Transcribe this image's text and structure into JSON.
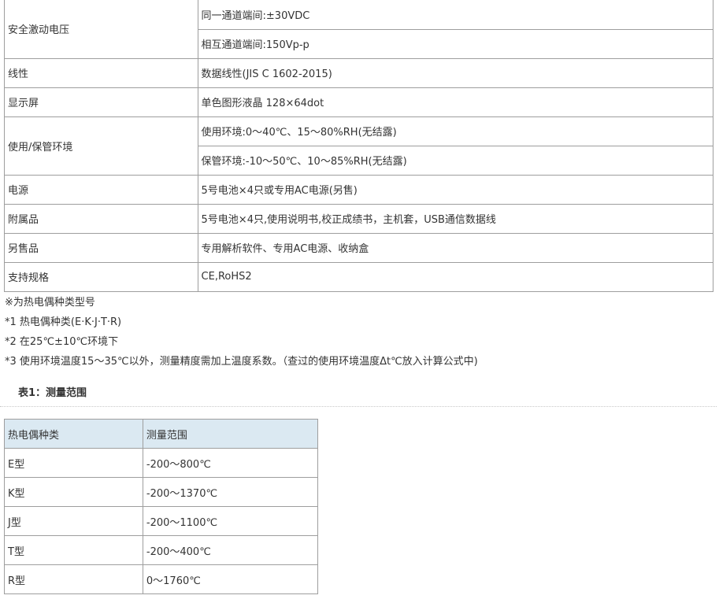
{
  "spec_table": {
    "rows": [
      {
        "label": "安全激动电压",
        "values": [
          "同一通道端间:±30VDC",
          "相互通道端间:150Vp-p"
        ]
      },
      {
        "label": "线性",
        "values": [
          "数据线性(JIS C 1602-2015)"
        ]
      },
      {
        "label": "显示屏",
        "values": [
          "单色图形液晶 128×64dot"
        ]
      },
      {
        "label": "使用/保管环境",
        "values": [
          "使用环境:0～40℃、15～80%RH(无结露)",
          "保管环境:-10～50℃、10～85%RH(无结露)"
        ]
      },
      {
        "label": "电源",
        "values": [
          "5号电池×4只或专用AC电源(另售)"
        ]
      },
      {
        "label": "附属品",
        "values": [
          "5号电池×4只,使用说明书,校正成绩书，主机套，USB通信数据线"
        ]
      },
      {
        "label": "另售品",
        "values": [
          "专用解析软件、专用AC电源、收纳盒"
        ]
      },
      {
        "label": "支持规格",
        "values": [
          "CE,RoHS2"
        ]
      }
    ]
  },
  "notes": [
    "※为热电偶种类型号",
    "*1 热电偶种类(E·K·J·T·R)",
    "*2 在25℃±10℃环境下",
    "*3 使用环境温度15～35℃以外，测量精度需加上温度系数。（查过的使用环境温度Δt℃放入计算公式中)"
  ],
  "section_title": "表1：测量范围",
  "range_table": {
    "headers": [
      "热电偶种类",
      "测量范围"
    ],
    "rows": [
      [
        "E型",
        "-200～800℃"
      ],
      [
        "K型",
        "-200～1370℃"
      ],
      [
        "J型",
        "-200～1100℃"
      ],
      [
        "T型",
        "-200～400℃"
      ],
      [
        "R型",
        "0～1760℃"
      ]
    ]
  },
  "colors": {
    "border": "#9e9e9e",
    "header_bg": "#dbe9f2",
    "text": "#333333"
  }
}
